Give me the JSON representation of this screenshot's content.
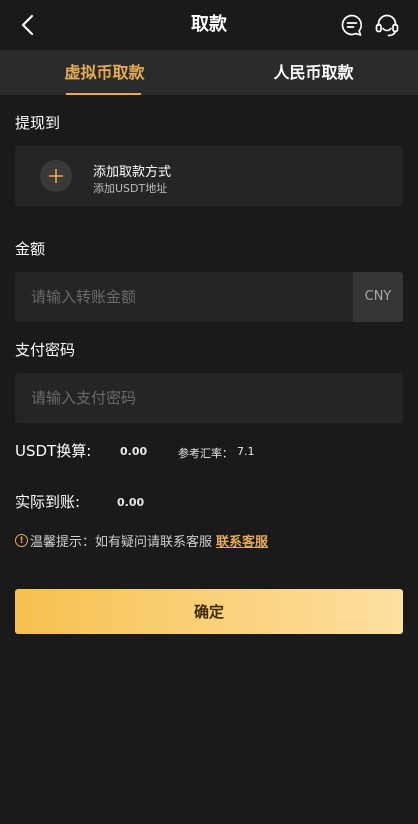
{
  "header": {
    "title": "取款",
    "back_icon": "back-chevron-icon",
    "chat_icon": "chat-icon",
    "service_icon": "headset-icon"
  },
  "tabs": [
    {
      "label": "虚拟币取款",
      "active": true
    },
    {
      "label": "人民币取款",
      "active": false
    }
  ],
  "withdraw_to": {
    "label": "提现到",
    "add_title": "添加取款方式",
    "add_subtitle": "添加USDT地址",
    "icon": "plus-icon"
  },
  "amount": {
    "label": "金额",
    "placeholder": "请输入转账金额",
    "value": "",
    "currency": "CNY"
  },
  "password": {
    "label": "支付密码",
    "placeholder": "请输入支付密码",
    "value": ""
  },
  "conversion": {
    "label": "USDT换算:",
    "value": "0.00",
    "rate_label": "参考汇率：",
    "rate_value": "7.1"
  },
  "actual": {
    "label": "实际到账:",
    "value": "0.00"
  },
  "tip": {
    "icon": "exclamation-circle-icon",
    "text": "温馨提示：如有疑问请联系客服",
    "link": "联系客服"
  },
  "confirm_button": "确定",
  "colors": {
    "background": "#1a1a1a",
    "accent": "#e4ab53",
    "card": "#252525",
    "tab_bar": "#2b2b2b"
  }
}
